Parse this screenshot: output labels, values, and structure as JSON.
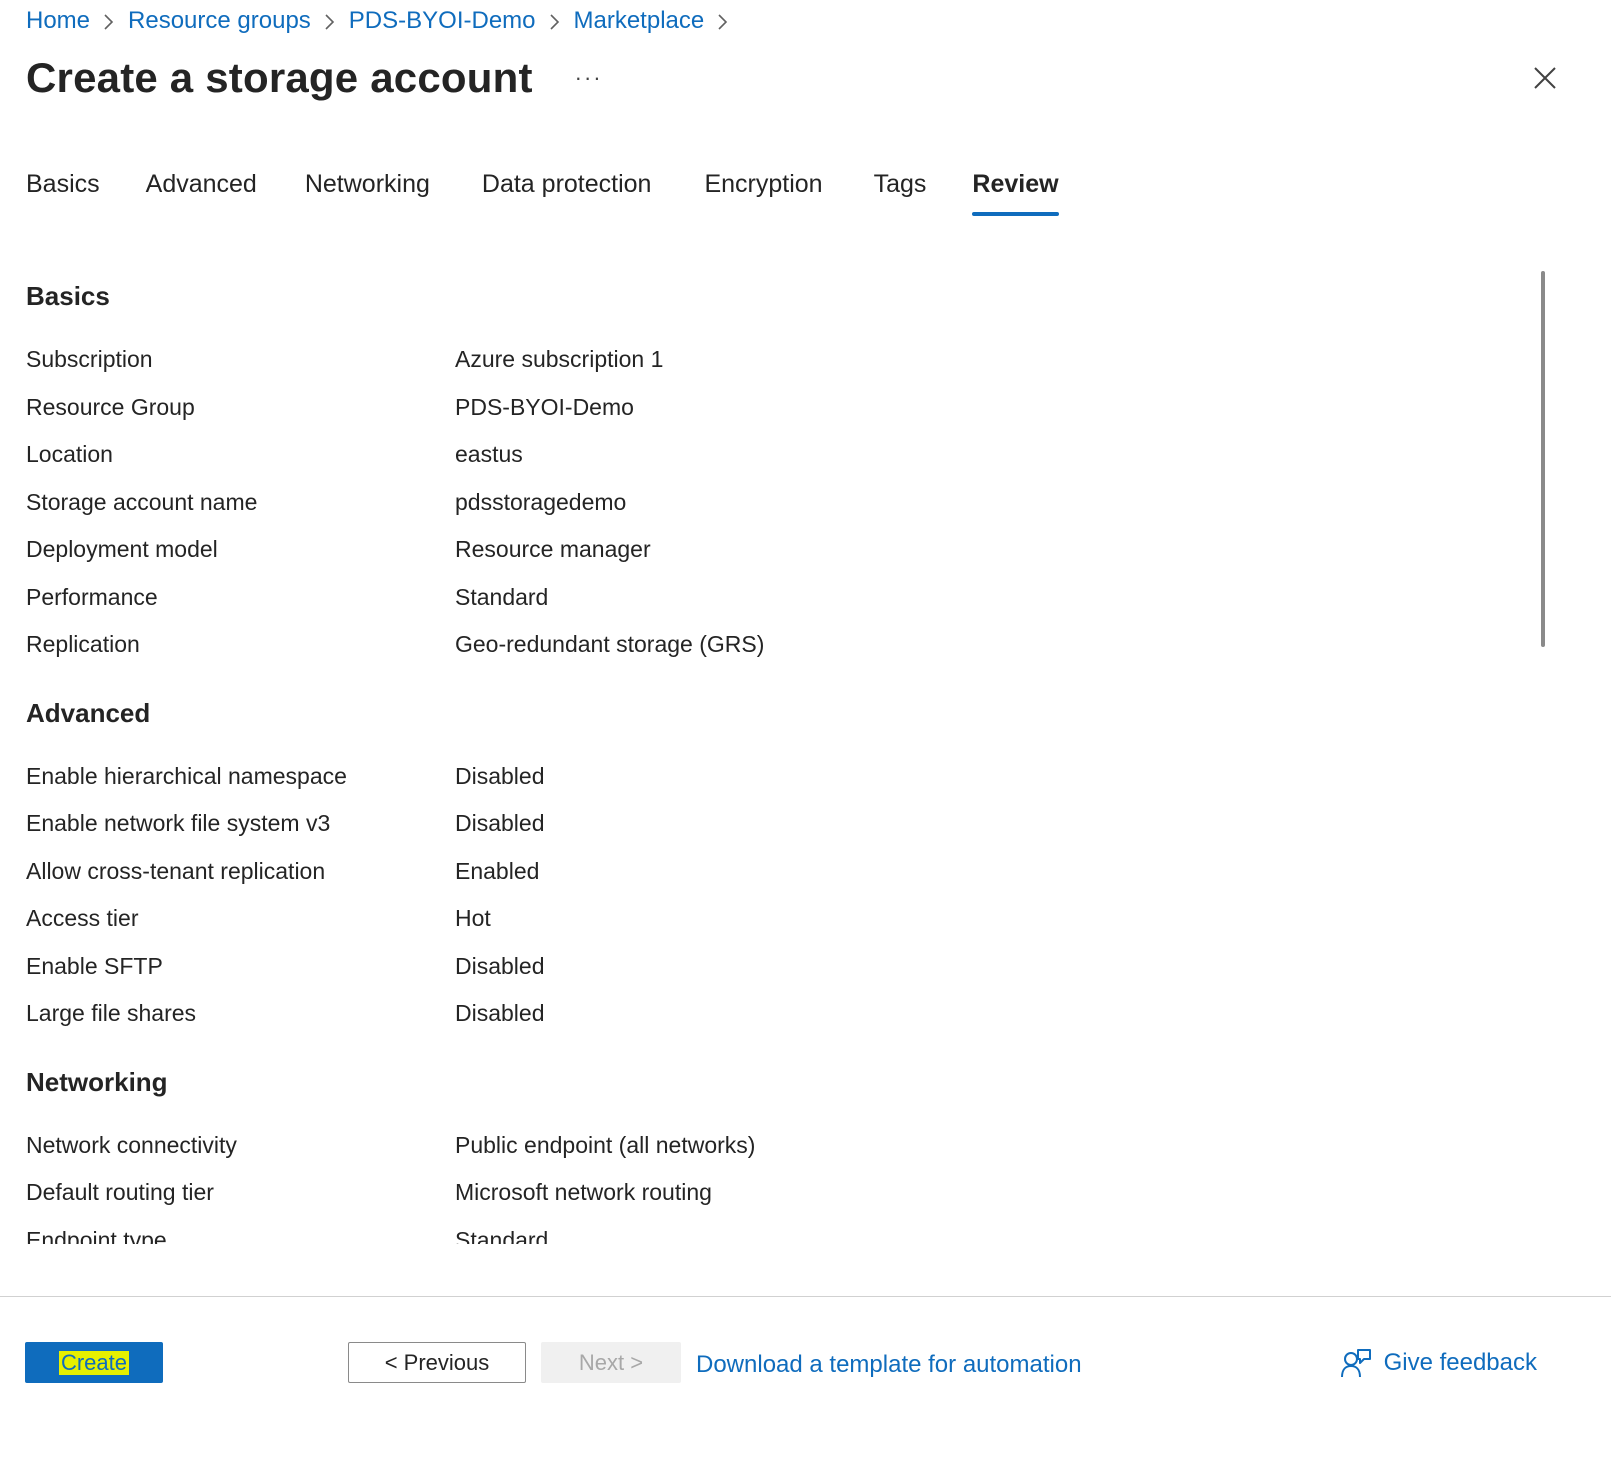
{
  "breadcrumb": [
    {
      "label": "Home"
    },
    {
      "label": "Resource groups"
    },
    {
      "label": "PDS-BYOI-Demo"
    },
    {
      "label": "Marketplace"
    }
  ],
  "header": {
    "title": "Create a storage account",
    "more_label": "···"
  },
  "tabs": [
    {
      "label": "Basics"
    },
    {
      "label": "Advanced"
    },
    {
      "label": "Networking"
    },
    {
      "label": "Data protection"
    },
    {
      "label": "Encryption"
    },
    {
      "label": "Tags"
    },
    {
      "label": "Review",
      "active": true
    }
  ],
  "sections": {
    "basics": {
      "title": "Basics",
      "rows": [
        {
          "label": "Subscription",
          "value": "Azure subscription 1"
        },
        {
          "label": "Resource Group",
          "value": "PDS-BYOI-Demo"
        },
        {
          "label": "Location",
          "value": "eastus"
        },
        {
          "label": "Storage account name",
          "value": "pdsstoragedemo"
        },
        {
          "label": "Deployment model",
          "value": "Resource manager"
        },
        {
          "label": "Performance",
          "value": "Standard"
        },
        {
          "label": "Replication",
          "value": "Geo-redundant storage (GRS)"
        }
      ]
    },
    "advanced": {
      "title": "Advanced",
      "rows": [
        {
          "label": "Enable hierarchical namespace",
          "value": "Disabled"
        },
        {
          "label": "Enable network file system v3",
          "value": "Disabled"
        },
        {
          "label": "Allow cross-tenant replication",
          "value": "Enabled"
        },
        {
          "label": "Access tier",
          "value": "Hot"
        },
        {
          "label": "Enable SFTP",
          "value": "Disabled"
        },
        {
          "label": "Large file shares",
          "value": "Disabled"
        }
      ]
    },
    "networking": {
      "title": "Networking",
      "rows": [
        {
          "label": "Network connectivity",
          "value": "Public endpoint (all networks)"
        },
        {
          "label": "Default routing tier",
          "value": "Microsoft network routing"
        },
        {
          "label": "Endpoint type",
          "value": "Standard"
        }
      ]
    }
  },
  "footer": {
    "create_label": "Create",
    "previous_label": "< Previous",
    "next_label": "Next >",
    "download_label": "Download a template for automation",
    "feedback_label": "Give feedback"
  },
  "colors": {
    "accent": "#0f6cbd",
    "highlight": "#e6f000"
  }
}
